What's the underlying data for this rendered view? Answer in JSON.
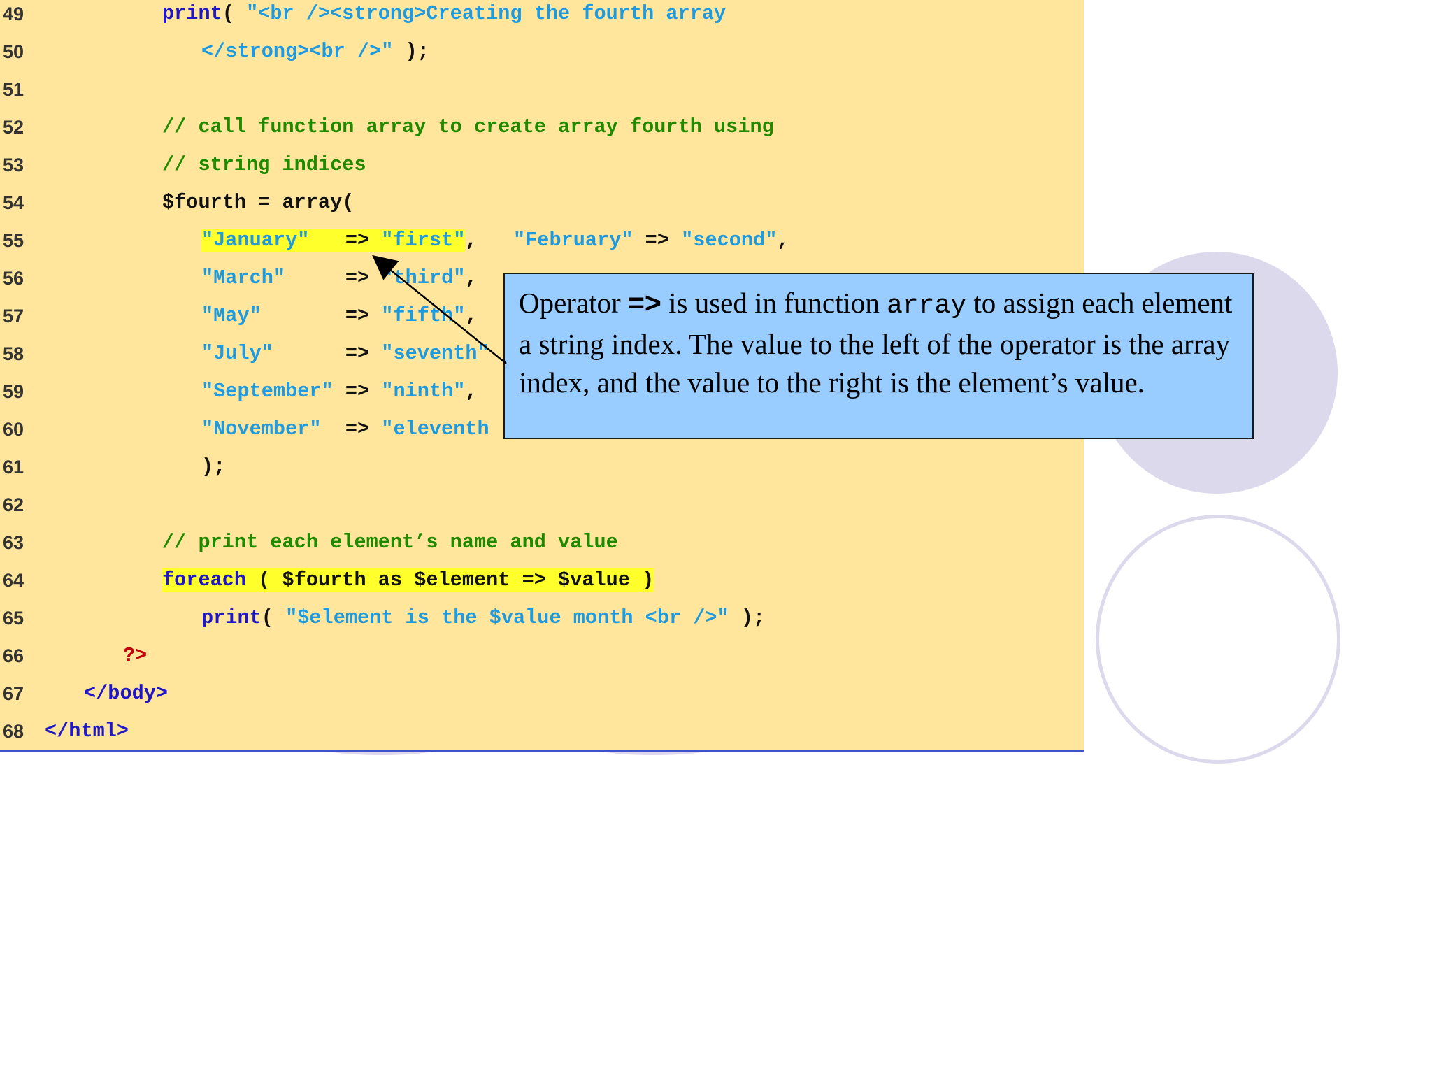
{
  "lines": [
    {
      "n": "49",
      "indent": 4,
      "parts": [
        {
          "c": "kw",
          "t": "print"
        },
        {
          "c": "tx",
          "t": "( "
        },
        {
          "c": "str",
          "t": "\"<br /><strong>Creating the fourth array"
        }
      ]
    },
    {
      "n": "50",
      "indent": 5,
      "parts": [
        {
          "c": "str",
          "t": "</strong><br />\""
        },
        {
          "c": "tx",
          "t": " );"
        }
      ]
    },
    {
      "n": "51",
      "indent": 0,
      "parts": []
    },
    {
      "n": "52",
      "indent": 4,
      "parts": [
        {
          "c": "cm",
          "t": "// call function array to create array fourth using"
        }
      ]
    },
    {
      "n": "53",
      "indent": 4,
      "parts": [
        {
          "c": "cm",
          "t": "// string indices"
        }
      ]
    },
    {
      "n": "54",
      "indent": 4,
      "parts": [
        {
          "c": "tx",
          "t": "$fourth = array("
        }
      ]
    },
    {
      "n": "55",
      "indent": 5,
      "parts": [
        {
          "c": "str hl",
          "t": "\"January\""
        },
        {
          "c": "tx hl",
          "t": "   => "
        },
        {
          "c": "str hl",
          "t": "\"first\""
        },
        {
          "c": "tx",
          "t": ",   "
        },
        {
          "c": "str",
          "t": "\"February\""
        },
        {
          "c": "tx",
          "t": " => "
        },
        {
          "c": "str",
          "t": "\"second\""
        },
        {
          "c": "tx",
          "t": ","
        }
      ]
    },
    {
      "n": "56",
      "indent": 5,
      "parts": [
        {
          "c": "str",
          "t": "\"March\""
        },
        {
          "c": "tx",
          "t": "     => "
        },
        {
          "c": "str",
          "t": "\"third\""
        },
        {
          "c": "tx",
          "t": ","
        }
      ]
    },
    {
      "n": "57",
      "indent": 5,
      "parts": [
        {
          "c": "str",
          "t": "\"May\""
        },
        {
          "c": "tx",
          "t": "       => "
        },
        {
          "c": "str",
          "t": "\"fifth\""
        },
        {
          "c": "tx",
          "t": ","
        }
      ]
    },
    {
      "n": "58",
      "indent": 5,
      "parts": [
        {
          "c": "str",
          "t": "\"July\""
        },
        {
          "c": "tx",
          "t": "      => "
        },
        {
          "c": "str",
          "t": "\"seventh\""
        }
      ]
    },
    {
      "n": "59",
      "indent": 5,
      "parts": [
        {
          "c": "str",
          "t": "\"September\""
        },
        {
          "c": "tx",
          "t": " => "
        },
        {
          "c": "str",
          "t": "\"ninth\""
        },
        {
          "c": "tx",
          "t": ","
        }
      ]
    },
    {
      "n": "60",
      "indent": 5,
      "parts": [
        {
          "c": "str",
          "t": "\"November\""
        },
        {
          "c": "tx",
          "t": "  => "
        },
        {
          "c": "str",
          "t": "\"eleventh"
        }
      ]
    },
    {
      "n": "61",
      "indent": 5,
      "parts": [
        {
          "c": "tx",
          "t": ");"
        }
      ]
    },
    {
      "n": "62",
      "indent": 0,
      "parts": []
    },
    {
      "n": "63",
      "indent": 4,
      "parts": [
        {
          "c": "cm",
          "t": "// print each element’s name and value"
        }
      ]
    },
    {
      "n": "64",
      "indent": 4,
      "parts": [
        {
          "c": "kw hl",
          "t": "foreach"
        },
        {
          "c": "tx hl",
          "t": " ( $fourth as $element => $value )"
        }
      ]
    },
    {
      "n": "65",
      "indent": 5,
      "parts": [
        {
          "c": "kw",
          "t": "print"
        },
        {
          "c": "tx",
          "t": "( "
        },
        {
          "c": "str",
          "t": "\"$element is the $value month <br />\""
        },
        {
          "c": "tx",
          "t": " );"
        }
      ]
    },
    {
      "n": "66",
      "indent": 3,
      "parts": [
        {
          "c": "php",
          "t": "?>"
        }
      ]
    },
    {
      "n": "67",
      "indent": 2,
      "parts": [
        {
          "c": "tag",
          "t": "</body>"
        }
      ]
    },
    {
      "n": "68",
      "indent": 1,
      "parts": [
        {
          "c": "tag",
          "t": "</html>"
        }
      ]
    }
  ],
  "callout": {
    "p1": "Operator ",
    "op": "=>",
    "p2": " is used in function ",
    "fn": "array",
    "p3": " to assign each element a string index. The value to the left of the operator is the array index, and the value to the right is the element’s value."
  }
}
